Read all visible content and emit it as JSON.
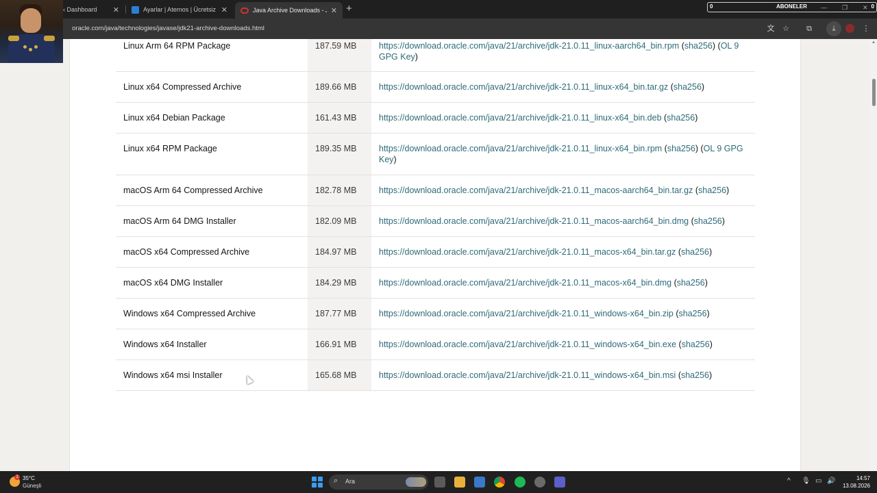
{
  "browser": {
    "tabs": [
      {
        "title": "‹ Dashboard",
        "active": false
      },
      {
        "title": "Ayarlar | Aternos | Ücretsiz Mine",
        "active": false
      },
      {
        "title": "Java Archive Downloads - Java",
        "active": true
      }
    ],
    "url": "oracle.com/java/technologies/javase/jdk21-archive-downloads.html"
  },
  "overlay": {
    "subscriber_label": "ABONELER",
    "subscriber_count_left": "0",
    "subscriber_count_right": "0"
  },
  "downloads": [
    {
      "product": "Linux Arm 64 RPM Package",
      "size": "187.59 MB",
      "url": "https://download.oracle.com/java/21/archive/jdk-21.0.11_linux-aarch64_bin.rpm",
      "extra_line1": "OL 9",
      "extra_line2": "GPG Key"
    },
    {
      "product": "Linux x64 Compressed Archive",
      "size": "189.66 MB",
      "url": "https://download.oracle.com/java/21/archive/jdk-21.0.11_linux-x64_bin.tar.gz"
    },
    {
      "product": "Linux x64 Debian Package",
      "size": "161.43 MB",
      "url": "https://download.oracle.com/java/21/archive/jdk-21.0.11_linux-x64_bin.deb"
    },
    {
      "product": "Linux x64 RPM Package",
      "size": "189.35 MB",
      "url": "https://download.oracle.com/java/21/archive/jdk-21.0.11_linux-x64_bin.rpm",
      "extra_line1": "OL 9 GPG",
      "extra_line2": "Key"
    },
    {
      "product": "macOS Arm 64 Compressed Archive",
      "size": "182.78 MB",
      "url": "https://download.oracle.com/java/21/archive/jdk-21.0.11_macos-aarch64_bin.tar.gz"
    },
    {
      "product": "macOS Arm 64 DMG Installer",
      "size": "182.09 MB",
      "url": "https://download.oracle.com/java/21/archive/jdk-21.0.11_macos-aarch64_bin.dmg"
    },
    {
      "product": "macOS x64 Compressed Archive",
      "size": "184.97 MB",
      "url": "https://download.oracle.com/java/21/archive/jdk-21.0.11_macos-x64_bin.tar.gz"
    },
    {
      "product": "macOS x64 DMG Installer",
      "size": "184.29 MB",
      "url": "https://download.oracle.com/java/21/archive/jdk-21.0.11_macos-x64_bin.dmg"
    },
    {
      "product": "Windows x64 Compressed Archive",
      "size": "187.77 MB",
      "url": "https://download.oracle.com/java/21/archive/jdk-21.0.11_windows-x64_bin.zip"
    },
    {
      "product": "Windows x64 Installer",
      "size": "166.91 MB",
      "url": "https://download.oracle.com/java/21/archive/jdk-21.0.11_windows-x64_bin.exe"
    },
    {
      "product": "Windows x64 msi Installer",
      "size": "165.68 MB",
      "url": "https://download.oracle.com/java/21/archive/jdk-21.0.11_windows-x64_bin.msi"
    }
  ],
  "checksum_label": "sha256",
  "taskbar": {
    "temperature": "35°C",
    "condition": "Güneşli",
    "weather_badge": "1",
    "search_placeholder": "Ara",
    "time": "14:57",
    "date": "13.08.2026"
  },
  "colors": {
    "link": "#2e6a78",
    "size_column_bg": "#f3f2f0"
  }
}
